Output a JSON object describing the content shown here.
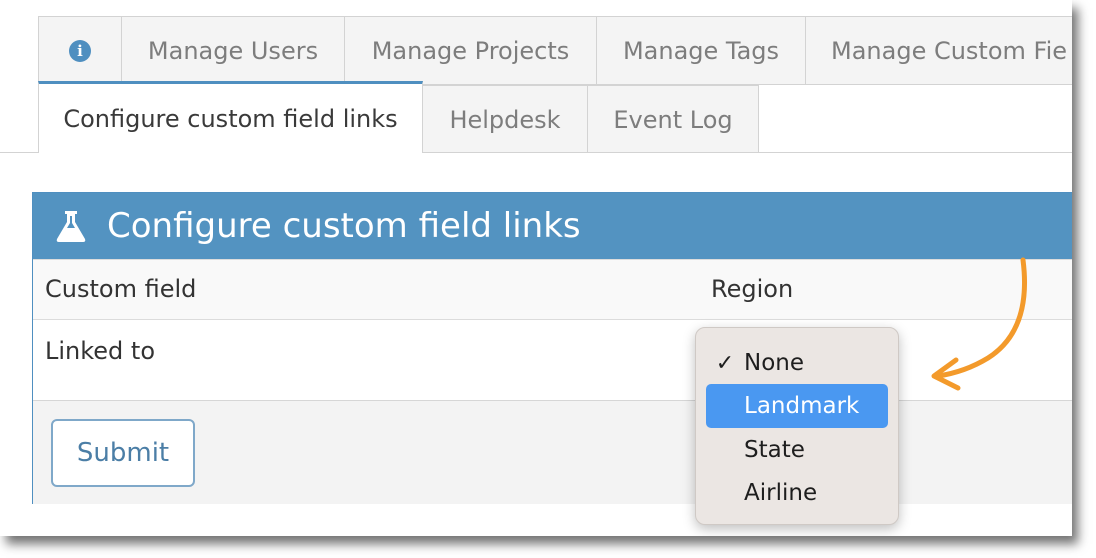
{
  "tabs_row1": [
    {
      "label": "",
      "icon": "info-icon"
    },
    {
      "label": "Manage Users"
    },
    {
      "label": "Manage Projects"
    },
    {
      "label": "Manage Tags"
    },
    {
      "label": "Manage Custom Fie"
    }
  ],
  "tabs_row2": [
    {
      "label": "Configure custom field links",
      "active": true
    },
    {
      "label": "Helpdesk"
    },
    {
      "label": "Event Log"
    }
  ],
  "panel": {
    "title": "Configure custom field links",
    "icon": "flask-icon",
    "rows": [
      {
        "key": "Custom field",
        "value": "Region"
      },
      {
        "key": "Linked to",
        "value": ""
      }
    ],
    "submit_label": "Submit"
  },
  "dropdown": {
    "options": [
      {
        "label": "None",
        "checked": true
      },
      {
        "label": "Landmark",
        "highlighted": true
      },
      {
        "label": "State"
      },
      {
        "label": "Airline"
      }
    ],
    "checkmark": "✓"
  },
  "colors": {
    "accent": "#5393c1",
    "highlight": "#4a98f1",
    "annotation_arrow": "#f39a2b"
  }
}
